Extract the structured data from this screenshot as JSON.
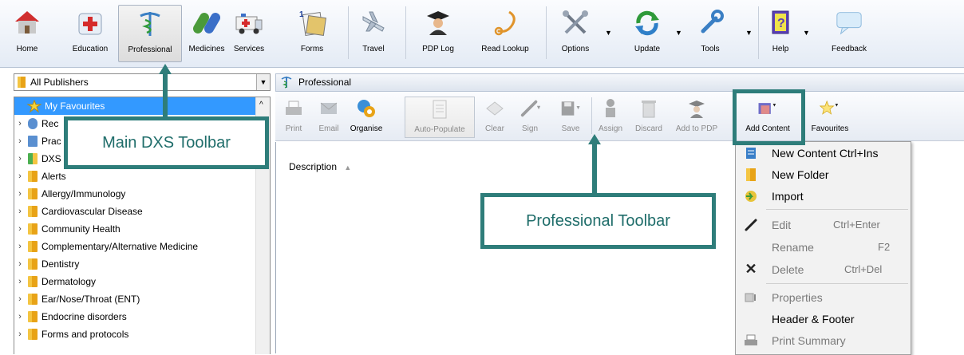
{
  "main_toolbar": {
    "buttons": [
      {
        "label": "Home",
        "icon": "home-icon"
      },
      {
        "label": "Education",
        "icon": "education-icon"
      },
      {
        "label": "Professional",
        "icon": "caduceus-icon",
        "active": true
      },
      {
        "label": "Medicines",
        "icon": "pills-icon"
      },
      {
        "label": "Services",
        "icon": "ambulance-icon"
      },
      {
        "label": "Forms",
        "icon": "forms-icon"
      },
      {
        "label": "Travel",
        "icon": "airplane-icon"
      },
      {
        "label": "PDP Log",
        "icon": "graduate-icon"
      },
      {
        "label": "Read Lookup",
        "icon": "stethoscope-icon"
      },
      {
        "label": "Options",
        "icon": "tools-icon"
      },
      {
        "label": "Update",
        "icon": "update-icon"
      },
      {
        "label": "Tools",
        "icon": "wrench-icon"
      },
      {
        "label": "Help",
        "icon": "help-book-icon"
      },
      {
        "label": "Feedback",
        "icon": "speech-bubble-icon"
      }
    ],
    "forms_badge": "1"
  },
  "left_panel": {
    "publisher_select": "All Publishers",
    "tree_items": [
      {
        "label": "My Favourites",
        "selected": true
      },
      {
        "label": "Rec"
      },
      {
        "label": "Prac"
      },
      {
        "label": "DXS"
      },
      {
        "label": "Alerts"
      },
      {
        "label": "Allergy/Immunology"
      },
      {
        "label": "Cardiovascular Disease"
      },
      {
        "label": "Community Health"
      },
      {
        "label": "Complementary/Alternative Medicine"
      },
      {
        "label": "Dentistry"
      },
      {
        "label": "Dermatology"
      },
      {
        "label": "Ear/Nose/Throat (ENT)"
      },
      {
        "label": "Endocrine disorders"
      },
      {
        "label": "Forms and protocols"
      }
    ]
  },
  "right_panel": {
    "title": "Professional",
    "toolbar": [
      {
        "label": "Print",
        "enabled": false,
        "icon": "printer-icon"
      },
      {
        "label": "Email",
        "enabled": false,
        "icon": "envelope-icon"
      },
      {
        "label": "Organise",
        "enabled": true,
        "icon": "organise-icon"
      },
      {
        "label": "Auto-Populate",
        "enabled": false,
        "icon": "document-icon"
      },
      {
        "label": "Clear",
        "enabled": false,
        "icon": "eraser-icon"
      },
      {
        "label": "Sign",
        "enabled": false,
        "icon": "pen-icon"
      },
      {
        "label": "Save",
        "enabled": false,
        "icon": "floppy-icon"
      },
      {
        "label": "Assign",
        "enabled": false,
        "icon": "assign-person-icon"
      },
      {
        "label": "Discard",
        "enabled": false,
        "icon": "trash-icon"
      },
      {
        "label": "Add to PDP",
        "enabled": false,
        "icon": "graduate-icon"
      },
      {
        "label": "Add Content",
        "enabled": true,
        "icon": "add-content-icon"
      },
      {
        "label": "Favourites",
        "enabled": true,
        "icon": "star-icon"
      }
    ],
    "column_header": "Description"
  },
  "context_menu": {
    "items": [
      {
        "label": "New Content Ctrl+Ins",
        "shortcut": "",
        "enabled": true,
        "icon": "new-content-icon"
      },
      {
        "label": "New Folder",
        "shortcut": "",
        "enabled": true,
        "icon": "folder-icon"
      },
      {
        "label": "Import",
        "shortcut": "",
        "enabled": true,
        "icon": "import-icon"
      },
      {
        "label": "Edit",
        "shortcut": "Ctrl+Enter",
        "enabled": false,
        "icon": "pencil-icon"
      },
      {
        "label": "Rename",
        "shortcut": "F2",
        "enabled": false,
        "icon": ""
      },
      {
        "label": "Delete",
        "shortcut": "Ctrl+Del",
        "enabled": false,
        "icon": "delete-x-icon"
      },
      {
        "label": "Properties",
        "shortcut": "",
        "enabled": false,
        "icon": "properties-icon"
      },
      {
        "label": "Header & Footer",
        "shortcut": "",
        "enabled": true,
        "icon": ""
      },
      {
        "label": "Print Summary",
        "shortcut": "",
        "enabled": false,
        "icon": "printer-icon"
      }
    ]
  },
  "annotations": {
    "main_toolbar_label": "Main DXS Toolbar",
    "professional_toolbar_label": "Professional Toolbar"
  },
  "colors": {
    "annotation": "#2e7d7a",
    "selection": "#3399ff"
  }
}
